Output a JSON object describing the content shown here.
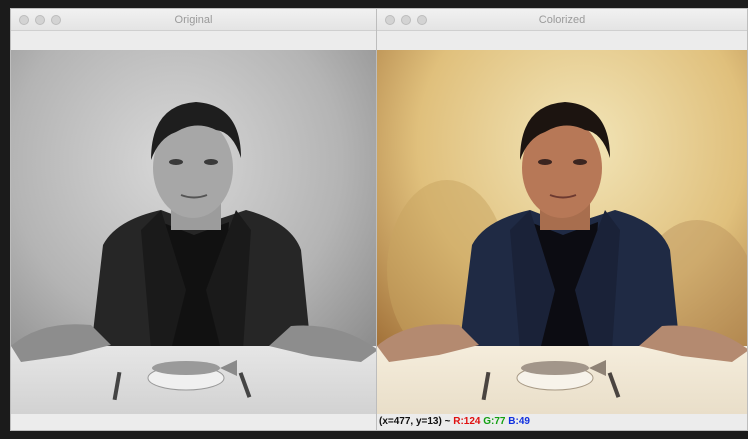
{
  "windows": {
    "original": {
      "title": "Original"
    },
    "colorized": {
      "title": "Colorized",
      "status": {
        "coords": "(x=477, y=13) ~",
        "r": "R:124",
        "g": "G:77",
        "b": "B:49"
      }
    }
  },
  "colors": {
    "desktop_bg": "#1b1b1b",
    "window_chrome": "#ececec",
    "status_red": "#e01010",
    "status_green": "#12a012",
    "status_blue": "#1030e0"
  },
  "icons": [
    "close-icon",
    "minimize-icon",
    "zoom-icon"
  ]
}
